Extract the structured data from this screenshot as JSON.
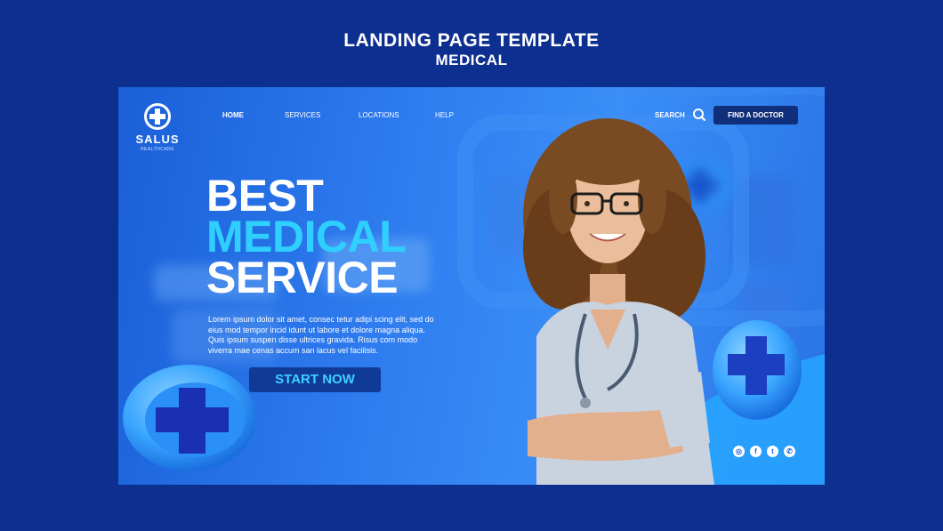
{
  "page": {
    "title": "LANDING PAGE TEMPLATE",
    "subtitle": "MEDICAL"
  },
  "logo": {
    "name": "SALUS",
    "tagline": "HEALTHCARE",
    "icon": "medical-cross-icon"
  },
  "nav": {
    "items": [
      {
        "label": "HOME",
        "active": true
      },
      {
        "label": "SERVICES",
        "active": false
      },
      {
        "label": "LOCATIONS",
        "active": false
      },
      {
        "label": "HELP",
        "active": false
      }
    ]
  },
  "header": {
    "search_label": "SEARCH",
    "search_icon": "search-icon",
    "find_doctor_label": "FIND A DOCTOR"
  },
  "hero": {
    "line1": "BEST",
    "line2": "MEDICAL",
    "line3": "SERVICE",
    "description": "Lorem ipsum dolor sit amet, consec tetur adipi scing elit, sed do eius mod tempor incid idunt ut labore et dolore magna aliqua. Quis ipsum suspen disse ultrices gravida. Risus com modo viverra mae cenas accum san lacus vel facilisis.",
    "cta_label": "START NOW"
  },
  "social": [
    {
      "icon": "instagram-icon",
      "glyph": "◎"
    },
    {
      "icon": "facebook-icon",
      "glyph": "f"
    },
    {
      "icon": "twitter-icon",
      "glyph": "t"
    },
    {
      "icon": "whatsapp-icon",
      "glyph": "✆"
    }
  ],
  "colors": {
    "page_background": "#0d2f8f",
    "card_blue": "#2f7df0",
    "accent_cyan": "#2fd0ff",
    "button_dark": "#0f3a96"
  }
}
